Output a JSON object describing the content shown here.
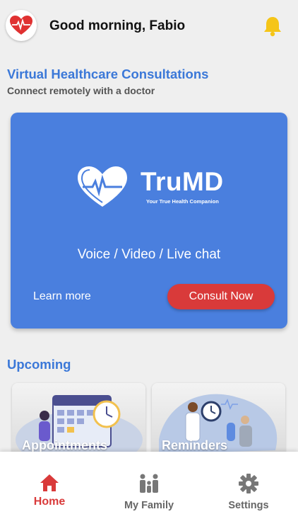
{
  "header": {
    "greeting": "Good morning, Fabio",
    "avatar_icon": "heart-pulse-icon",
    "notification_icon": "bell-icon"
  },
  "intro": {
    "title": "Virtual Healthcare Consultations",
    "subtitle": "Connect remotely with a doctor"
  },
  "promo_card": {
    "brand_name": "TruMD",
    "brand_tagline": "Your True Health Companion",
    "modes": "Voice / Video / Live chat",
    "learn_more_label": "Learn more",
    "consult_label": "Consult Now"
  },
  "upcoming": {
    "title": "Upcoming",
    "tiles": [
      {
        "label": "Appointments",
        "icon": "calendar-clock-illustration"
      },
      {
        "label": "Reminders",
        "icon": "doctor-patient-illustration"
      }
    ]
  },
  "bottom_nav": {
    "items": [
      {
        "label": "Home",
        "icon": "home-icon",
        "active": true
      },
      {
        "label": "My Family",
        "icon": "family-icon",
        "active": false
      },
      {
        "label": "Settings",
        "icon": "gear-icon",
        "active": false
      }
    ]
  },
  "colors": {
    "accent_blue": "#3b78d8",
    "card_blue": "#4a7fde",
    "action_red": "#d93a3a",
    "bell_yellow": "#f5c518"
  }
}
